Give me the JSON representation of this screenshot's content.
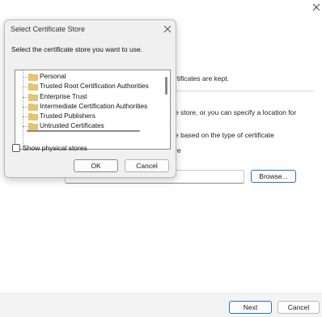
{
  "wizard": {
    "text_line1": "rtificates are kept.",
    "text_line2": "e store, or you can specify a location for",
    "text_line3": "e based on the type of certificate",
    "text_line4": "re",
    "browse_label": "Browse...",
    "next_label": "Next",
    "cancel_label": "Cancel",
    "close_icon": "close-icon"
  },
  "dialog": {
    "title": "Select Certificate Store",
    "prompt": "Select the certificate store you want to use.",
    "stores": [
      {
        "label": "Personal"
      },
      {
        "label": "Trusted Root Certification Authorities"
      },
      {
        "label": "Enterprise Trust"
      },
      {
        "label": "Intermediate Certification Authorities"
      },
      {
        "label": "Trusted Publishers"
      },
      {
        "label": "Untrusted Certificates"
      }
    ],
    "show_physical_label": "Show physical stores",
    "show_physical_checked": false,
    "ok_label": "OK",
    "cancel_label": "Cancel",
    "folder_color": "#e9c46a",
    "accent_color": "#2a6fcf"
  }
}
